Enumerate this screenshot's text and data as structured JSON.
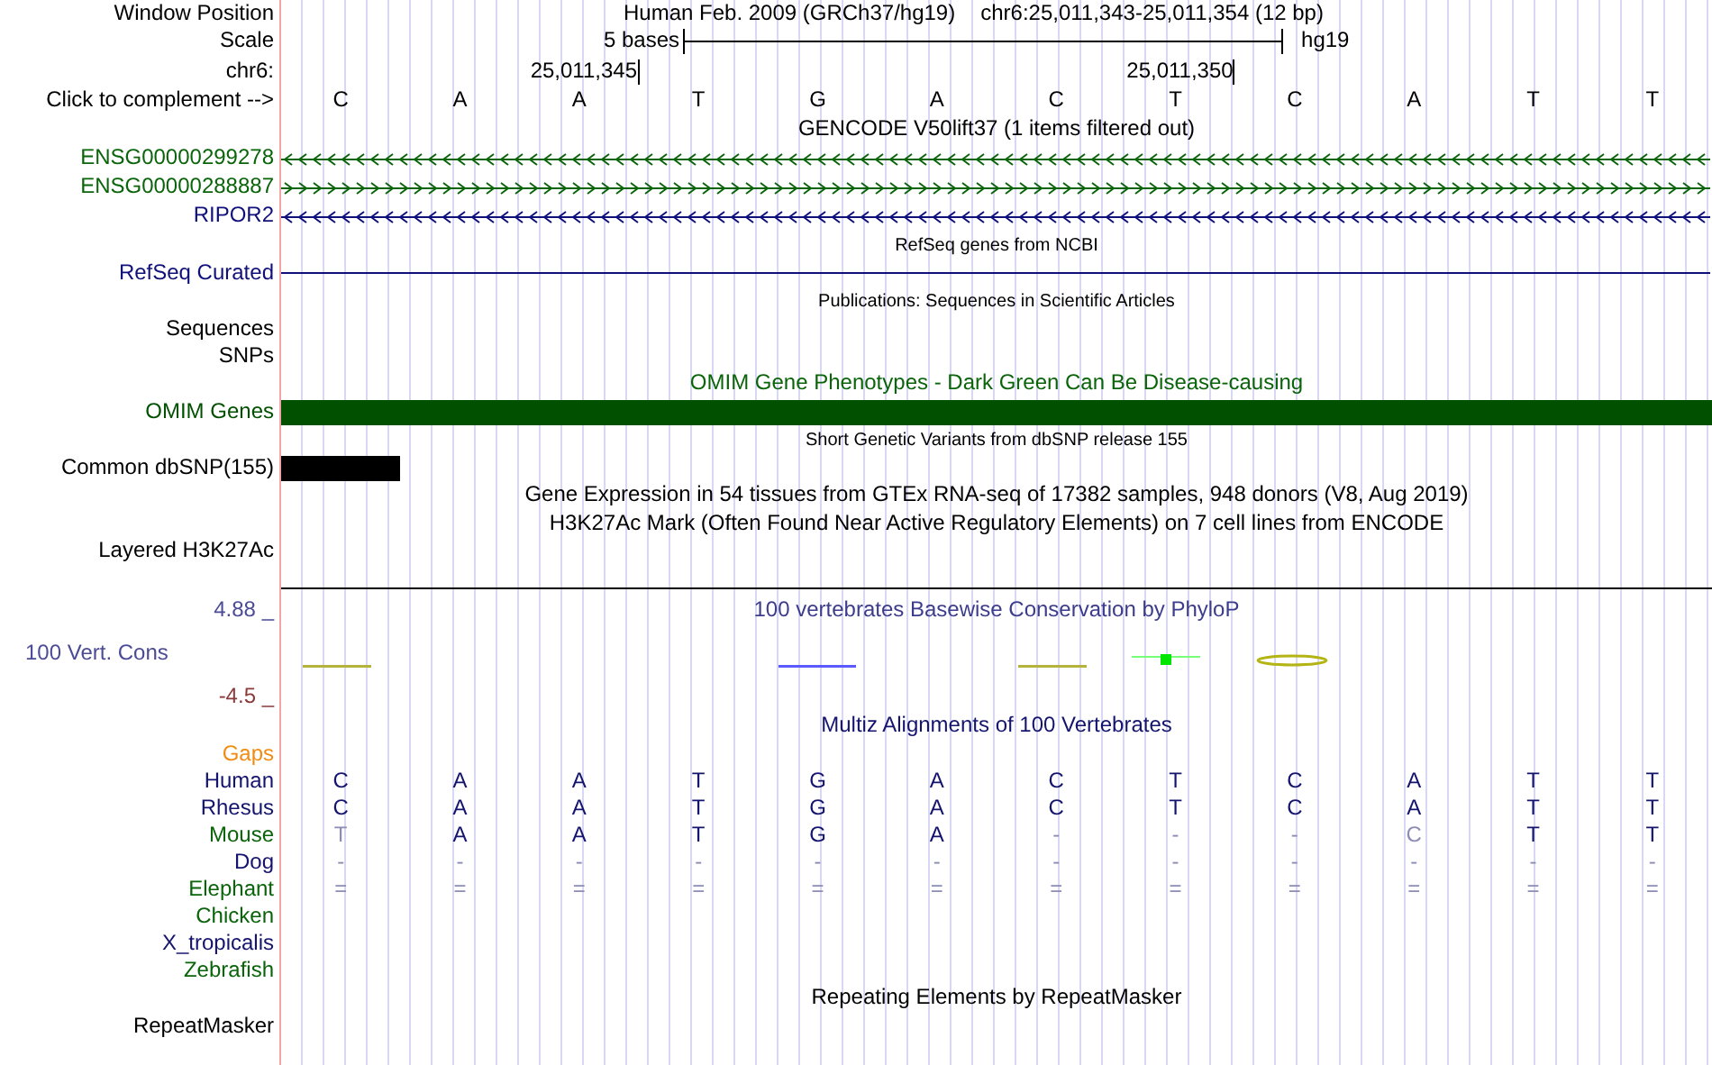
{
  "rows": [
    {
      "kind": "position",
      "label": "Window Position",
      "assembly": "Human Feb. 2009 (GRCh37/hg19)",
      "position": "chr6:25,011,343-25,011,354 (12 bp)"
    },
    {
      "kind": "scale",
      "label": "Scale",
      "text": "5 bases",
      "db": "hg19"
    },
    {
      "kind": "ruler",
      "label": "chr6:",
      "ticks": [
        "25,011,345",
        "25,011,350"
      ]
    },
    {
      "kind": "bases",
      "label": "Click to complement -->",
      "bases": [
        "C",
        "A",
        "A",
        "T",
        "G",
        "A",
        "C",
        "T",
        "C",
        "A",
        "T",
        "T"
      ]
    },
    {
      "kind": "title",
      "text": "GENCODE V50lift37 (1 items filtered out)"
    },
    {
      "kind": "gene",
      "label": "ENSG00000299278",
      "reverse": true,
      "color": "#0a640a"
    },
    {
      "kind": "gene",
      "label": "ENSG00000288887",
      "reverse": false,
      "color": "#0a640a"
    },
    {
      "kind": "gene",
      "label": "RIPOR2",
      "reverse": true,
      "color": "#10107a"
    },
    {
      "kind": "caption",
      "text": "RefSeq genes from NCBI"
    },
    {
      "kind": "line",
      "label": "RefSeq Curated",
      "color": "#10107a"
    },
    {
      "kind": "caption",
      "text": "Publications: Sequences in Scientific Articles"
    },
    {
      "kind": "label",
      "label": "Sequences"
    },
    {
      "kind": "label",
      "label": "SNPs"
    },
    {
      "kind": "title",
      "text": "OMIM Gene Phenotypes - Dark Green Can Be Disease-causing",
      "color": "#0a640a"
    },
    {
      "kind": "bar",
      "label": "OMIM Genes",
      "color": "#005000"
    },
    {
      "kind": "caption",
      "text": "Short Genetic Variants from dbSNP release 155"
    },
    {
      "kind": "snp",
      "label": "Common dbSNP(155)",
      "color": "#000000"
    },
    {
      "kind": "title",
      "text": "Gene Expression in 54 tissues from GTEx RNA-seq of 17382 samples, 948 donors (V8, Aug 2019)"
    },
    {
      "kind": "title",
      "text": "H3K27Ac Mark (Often Found Near Active Regulatory Elements) on 7 cell lines from ENCODE"
    },
    {
      "kind": "layered",
      "label": "Layered H3K27Ac"
    },
    {
      "kind": "wiggle",
      "label": "100 Vert. Cons",
      "max": "4.88 _",
      "min": "-4.5 _",
      "title": "100 vertebrates Basewise Conservation by PhyloP"
    },
    {
      "kind": "title",
      "text": "Multiz Alignments of 100 Vertebrates",
      "color": "#14146e"
    },
    {
      "kind": "label",
      "label": "Gaps",
      "color": "#f08c14"
    },
    {
      "kind": "species",
      "label": "Human",
      "color": "#14146e",
      "bases": [
        {
          "b": "C",
          "match": true
        },
        {
          "b": "A",
          "match": true
        },
        {
          "b": "A",
          "match": true
        },
        {
          "b": "T",
          "match": true
        },
        {
          "b": "G",
          "match": true
        },
        {
          "b": "A",
          "match": true
        },
        {
          "b": "C",
          "match": true
        },
        {
          "b": "T",
          "match": true
        },
        {
          "b": "C",
          "match": true
        },
        {
          "b": "A",
          "match": true
        },
        {
          "b": "T",
          "match": true
        },
        {
          "b": "T",
          "match": true
        }
      ]
    },
    {
      "kind": "species",
      "label": "Rhesus",
      "color": "#14146e",
      "bases": [
        {
          "b": "C",
          "match": true
        },
        {
          "b": "A",
          "match": true
        },
        {
          "b": "A",
          "match": true
        },
        {
          "b": "T",
          "match": true
        },
        {
          "b": "G",
          "match": true
        },
        {
          "b": "A",
          "match": true
        },
        {
          "b": "C",
          "match": true
        },
        {
          "b": "T",
          "match": true
        },
        {
          "b": "C",
          "match": true
        },
        {
          "b": "A",
          "match": true
        },
        {
          "b": "T",
          "match": true
        },
        {
          "b": "T",
          "match": true
        }
      ]
    },
    {
      "kind": "species",
      "label": "Mouse",
      "color": "#0a640a",
      "bases": [
        {
          "b": "T",
          "match": false
        },
        {
          "b": "A",
          "match": true
        },
        {
          "b": "A",
          "match": true
        },
        {
          "b": "T",
          "match": true
        },
        {
          "b": "G",
          "match": true
        },
        {
          "b": "A",
          "match": true
        },
        {
          "b": "-",
          "match": false
        },
        {
          "b": "-",
          "match": false
        },
        {
          "b": "-",
          "match": false
        },
        {
          "b": "C",
          "match": false
        },
        {
          "b": "T",
          "match": true
        },
        {
          "b": "T",
          "match": true
        }
      ]
    },
    {
      "kind": "species",
      "label": "Dog",
      "color": "#14146e",
      "bases": [
        {
          "b": "-",
          "match": false
        },
        {
          "b": "-",
          "match": false
        },
        {
          "b": "-",
          "match": false
        },
        {
          "b": "-",
          "match": false
        },
        {
          "b": "-",
          "match": false
        },
        {
          "b": "-",
          "match": false
        },
        {
          "b": "-",
          "match": false
        },
        {
          "b": "-",
          "match": false
        },
        {
          "b": "-",
          "match": false
        },
        {
          "b": "-",
          "match": false
        },
        {
          "b": "-",
          "match": false
        },
        {
          "b": "-",
          "match": false
        }
      ]
    },
    {
      "kind": "species",
      "label": "Elephant",
      "color": "#0a640a",
      "bases": [
        {
          "b": "=",
          "match": false
        },
        {
          "b": "=",
          "match": false
        },
        {
          "b": "=",
          "match": false
        },
        {
          "b": "=",
          "match": false
        },
        {
          "b": "=",
          "match": false
        },
        {
          "b": "=",
          "match": false
        },
        {
          "b": "=",
          "match": false
        },
        {
          "b": "=",
          "match": false
        },
        {
          "b": "=",
          "match": false
        },
        {
          "b": "=",
          "match": false
        },
        {
          "b": "=",
          "match": false
        },
        {
          "b": "=",
          "match": false
        }
      ]
    },
    {
      "kind": "species",
      "label": "Chicken",
      "color": "#0a640a"
    },
    {
      "kind": "species",
      "label": "X_tropicalis",
      "color": "#14146e"
    },
    {
      "kind": "species",
      "label": "Zebrafish",
      "color": "#0a640a"
    },
    {
      "kind": "title",
      "text": "Repeating Elements by RepeatMasker"
    },
    {
      "kind": "label",
      "label": "RepeatMasker"
    }
  ]
}
